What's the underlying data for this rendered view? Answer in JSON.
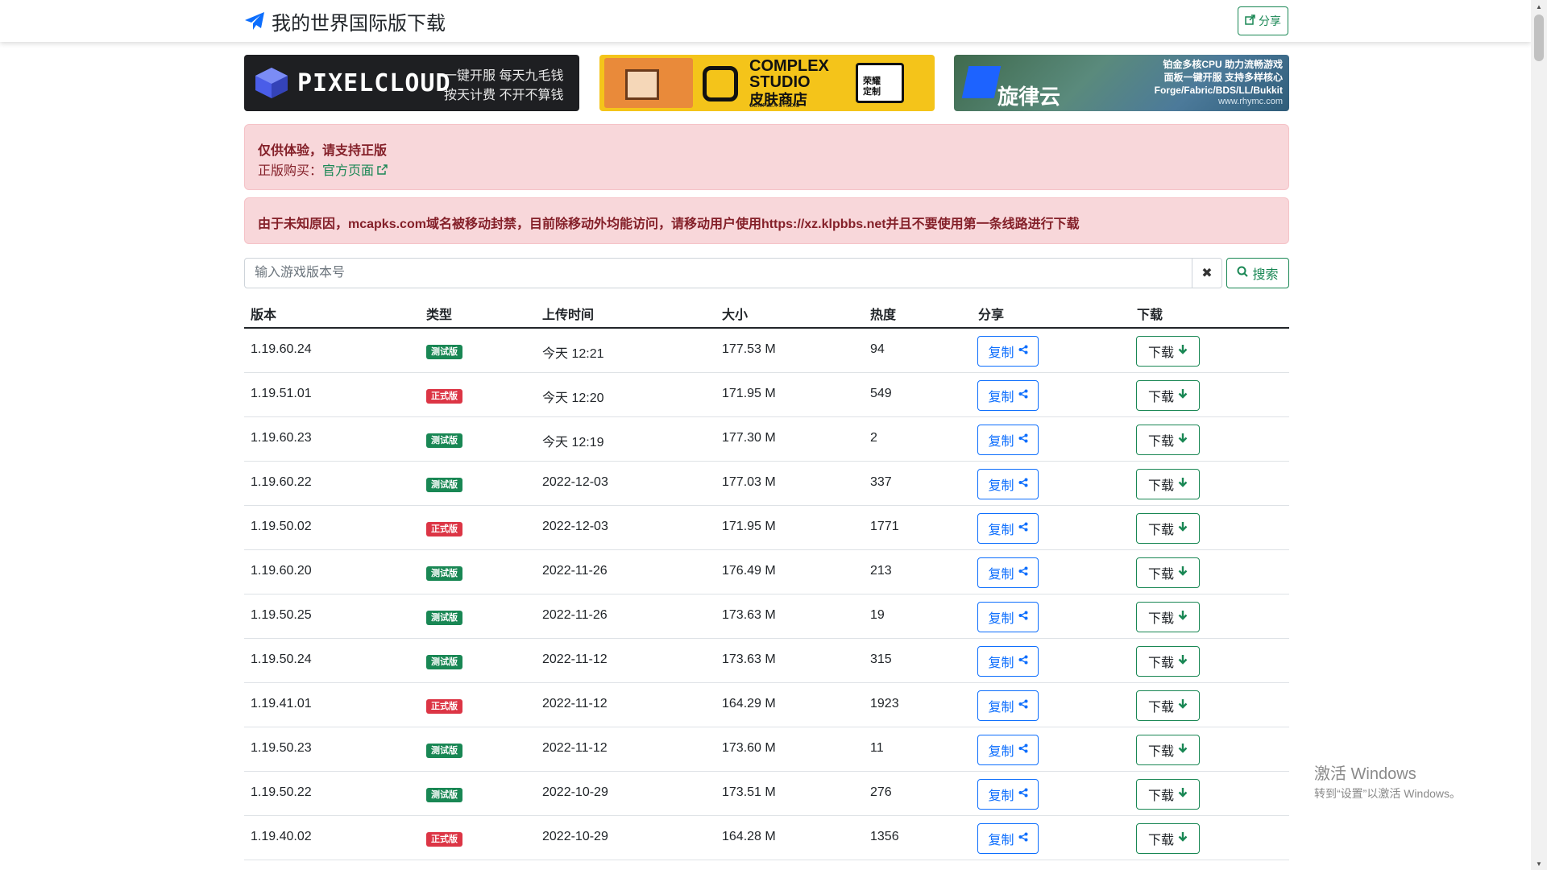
{
  "navbar": {
    "title": "我的世界国际版下载",
    "share_label": "分享"
  },
  "banners": {
    "pixelcloud": {
      "name": "PIXELCLOUD",
      "tag1": "一键开服  每天九毛钱",
      "tag2": "按天计费  不开不算钱"
    },
    "complex": {
      "title1": "COMPLEX",
      "title2": "STUDIO",
      "sub": "皮肤商店",
      "small": "COMPLEX STUDIO",
      "card": "荣耀\n定制"
    },
    "rhymc": {
      "name": "旋律云",
      "line1": "铂金多核CPU  助力流畅游戏",
      "line2": "面板一键开服  支持多样核心",
      "line3": "Forge/Fabric/BDS/LL/Bukkit",
      "url": "www.rhymc.com"
    }
  },
  "alert1": {
    "title": "仅供体验，请支持正版",
    "buy_label": "正版购买：",
    "link_text": "官方页面"
  },
  "alert2": {
    "text": "由于未知原因，mcapks.com域名被移动封禁，目前除移动外均能访问，请移动用户使用https://xz.klpbbs.net并且不要使用第一条线路进行下载"
  },
  "search": {
    "placeholder": "输入游戏版本号",
    "clear_icon": "✖",
    "button_label": "搜索"
  },
  "table": {
    "headers": [
      "版本",
      "类型",
      "上传时间",
      "大小",
      "热度",
      "分享",
      "下载"
    ],
    "copy_label": "复制",
    "download_label": "下载",
    "rows": [
      {
        "version": "1.19.60.24",
        "type": "测试版",
        "kind": "test",
        "time": "今天 12:21",
        "size": "177.53 M",
        "heat": "94"
      },
      {
        "version": "1.19.51.01",
        "type": "正式版",
        "kind": "stable",
        "time": "今天 12:20",
        "size": "171.95 M",
        "heat": "549"
      },
      {
        "version": "1.19.60.23",
        "type": "测试版",
        "kind": "test",
        "time": "今天 12:19",
        "size": "177.30 M",
        "heat": "2"
      },
      {
        "version": "1.19.60.22",
        "type": "测试版",
        "kind": "test",
        "time": "2022-12-03",
        "size": "177.03 M",
        "heat": "337"
      },
      {
        "version": "1.19.50.02",
        "type": "正式版",
        "kind": "stable",
        "time": "2022-12-03",
        "size": "171.95 M",
        "heat": "1771"
      },
      {
        "version": "1.19.60.20",
        "type": "测试版",
        "kind": "test",
        "time": "2022-11-26",
        "size": "176.49 M",
        "heat": "213"
      },
      {
        "version": "1.19.50.25",
        "type": "测试版",
        "kind": "test",
        "time": "2022-11-26",
        "size": "173.63 M",
        "heat": "19"
      },
      {
        "version": "1.19.50.24",
        "type": "测试版",
        "kind": "test",
        "time": "2022-11-12",
        "size": "173.63 M",
        "heat": "315"
      },
      {
        "version": "1.19.41.01",
        "type": "正式版",
        "kind": "stable",
        "time": "2022-11-12",
        "size": "164.29 M",
        "heat": "1923"
      },
      {
        "version": "1.19.50.23",
        "type": "测试版",
        "kind": "test",
        "time": "2022-11-12",
        "size": "173.60 M",
        "heat": "11"
      },
      {
        "version": "1.19.50.22",
        "type": "测试版",
        "kind": "test",
        "time": "2022-10-29",
        "size": "173.51 M",
        "heat": "276"
      },
      {
        "version": "1.19.40.02",
        "type": "正式版",
        "kind": "stable",
        "time": "2022-10-29",
        "size": "164.28 M",
        "heat": "1356"
      }
    ]
  },
  "watermark": {
    "title": "激活 Windows",
    "sub": "转到“设置”以激活 Windows。"
  },
  "colors": {
    "accent_green": "#198754",
    "accent_blue": "#0d6efd",
    "danger": "#dc3545",
    "alert_bg": "#f8d7da",
    "alert_text": "#842029"
  }
}
